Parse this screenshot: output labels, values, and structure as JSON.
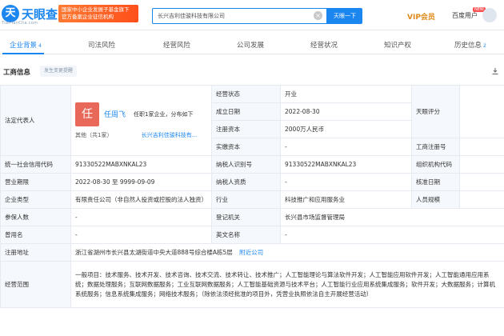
{
  "brand": {
    "logo_char": "天",
    "name": "天眼查",
    "tagline": "TianYanCha.com"
  },
  "ad": {
    "line1": "国家中小企业发展子基金旗下",
    "line2": "官方备案企业征信机构"
  },
  "search": {
    "value": "长兴吉利佳骏科技有限公司",
    "button": "天眼一下"
  },
  "header": {
    "vip": "VIP会员",
    "user": "百度用户",
    "badge": "NEW"
  },
  "tabs": [
    {
      "label": "企业背景",
      "count": "4"
    },
    {
      "label": "司法风险"
    },
    {
      "label": "经营风险"
    },
    {
      "label": "公司发展"
    },
    {
      "label": "经营状况"
    },
    {
      "label": "知识产权"
    },
    {
      "label": "历史信息",
      "count": "2"
    }
  ],
  "section": {
    "title": "工商信息",
    "tag": "发生变更提醒"
  },
  "rep": {
    "label": "法定代表人",
    "avatar_char": "任",
    "name": "任周飞",
    "meta": "任职1家企业，分布如下",
    "others": "其他（共1家）",
    "company": "长兴吉利佳骏科技有..."
  },
  "rows": {
    "status_label": "经营状态",
    "status": "开业",
    "established_label": "成立日期",
    "established": "2022-08-30",
    "capital_label": "注册资本",
    "capital": "2000万人民币",
    "paidin_label": "实缴资本",
    "paidin": "-",
    "score_label": "天眼评分",
    "score": "",
    "regno_label": "工商注册号",
    "regno": "",
    "credit_label": "统一社会信用代码",
    "credit": "91330522MABXNKAL23",
    "taxid_label": "纳税人识别号",
    "taxid": "91330522MABXNKAL23",
    "orgcode_label": "组织机构代码",
    "orgcode": "",
    "term_label": "营业期限",
    "term": "2022-08-30 至 9999-09-09",
    "taxpayer_label": "纳税人资质",
    "taxpayer": "-",
    "approval_label": "核准日期",
    "approval": "",
    "type_label": "企业类型",
    "type": "有限责任公司（非自然人投资或控股的法人独资）",
    "industry_label": "行业",
    "industry": "科技推广和应用服务业",
    "staff_label": "人员规模",
    "staff": "",
    "insured_label": "参保人数",
    "insured": "-",
    "authority_label": "登记机关",
    "authority": "长兴县市场监督管理局",
    "former_label": "曾用名",
    "former": "-",
    "english_label": "英文名称",
    "english": "-",
    "address_label": "注册地址",
    "address": "浙江省湖州市长兴县太湖街道中央大道888号综合楼A栋5层",
    "address_link": "附近公司",
    "scope_label": "经营范围",
    "scope": "一般项目：技术服务、技术开发、技术咨询、技术交流、技术转让、技术推广；人工智能理论与算法软件开发；人工智能应用软件开发；人工智能通用应用系统；数据处理服务；互联网数据服务；工业互联网数据服务；人工智能基础资源与技术平台；人工智能行业应用系统集成服务；软件开发；大数据服务；计算机系统服务；信息系统集成服务；网络技术服务；（除依法须经批准的项目外，凭营业执照依法自主开展经营活动）"
  },
  "colors": {
    "accent": "#1b86f0",
    "avatar": "#e8695a",
    "label_bg": "#f5f8fc"
  }
}
